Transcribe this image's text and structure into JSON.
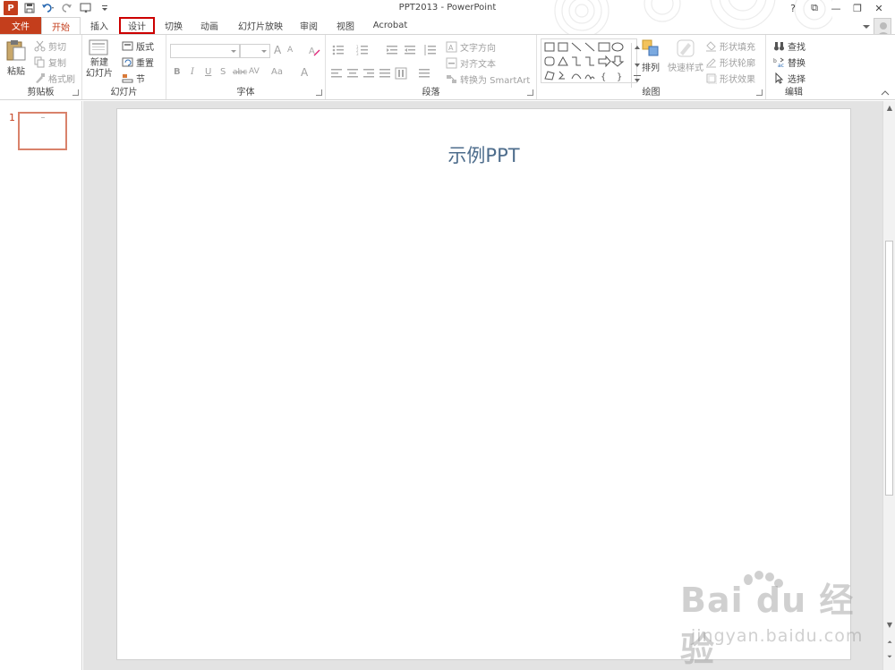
{
  "window": {
    "title": "PPT2013 - PowerPoint",
    "logo": "P",
    "controls": [
      "?",
      "⧉",
      "—",
      "❐",
      "✕"
    ]
  },
  "tabs": [
    {
      "label": "文件",
      "state": "file"
    },
    {
      "label": "开始",
      "state": "active"
    },
    {
      "label": "插入",
      "state": "normal"
    },
    {
      "label": "设计",
      "state": "highlighted"
    },
    {
      "label": "切换",
      "state": "normal"
    },
    {
      "label": "动画",
      "state": "normal"
    },
    {
      "label": "幻灯片放映",
      "state": "normal"
    },
    {
      "label": "审阅",
      "state": "normal"
    },
    {
      "label": "视图",
      "state": "normal"
    },
    {
      "label": "Acrobat",
      "state": "normal"
    }
  ],
  "ribbon": {
    "clipboard": {
      "label": "剪贴板",
      "paste": "粘贴",
      "cut": "剪切",
      "copy": "复制",
      "format_painter": "格式刷"
    },
    "slides": {
      "label": "幻灯片",
      "new_slide_1": "新建",
      "new_slide_2": "幻灯片",
      "layout": "版式",
      "reset": "重置",
      "section": "节"
    },
    "font": {
      "label": "字体",
      "bold": "B",
      "italic": "I",
      "underline": "U",
      "shadow": "S",
      "strike": "abc",
      "spacing": "AV",
      "case": "Aa",
      "color": "A",
      "grow": "A",
      "shrink": "A"
    },
    "paragraph": {
      "label": "段落",
      "text_direction": "文字方向",
      "align_text": "对齐文本",
      "smartart": "转换为 SmartArt"
    },
    "drawing": {
      "label": "绘图",
      "arrange": "排列",
      "quick_styles": "快速样式",
      "shape_fill": "形状填充",
      "shape_outline": "形状轮廓",
      "shape_effects": "形状效果"
    },
    "editing": {
      "label": "编辑",
      "find": "查找",
      "replace": "替换",
      "select": "选择"
    }
  },
  "thumbnails": [
    {
      "number": "1"
    }
  ],
  "slide": {
    "title": "示例PPT"
  },
  "watermark": {
    "logo": "Bai du 经验",
    "sub": "jingyan.baidu.com"
  },
  "colors": {
    "accent": "#c43e1c",
    "highlight_border": "#cc0000",
    "title_text": "#4e6d8c"
  }
}
